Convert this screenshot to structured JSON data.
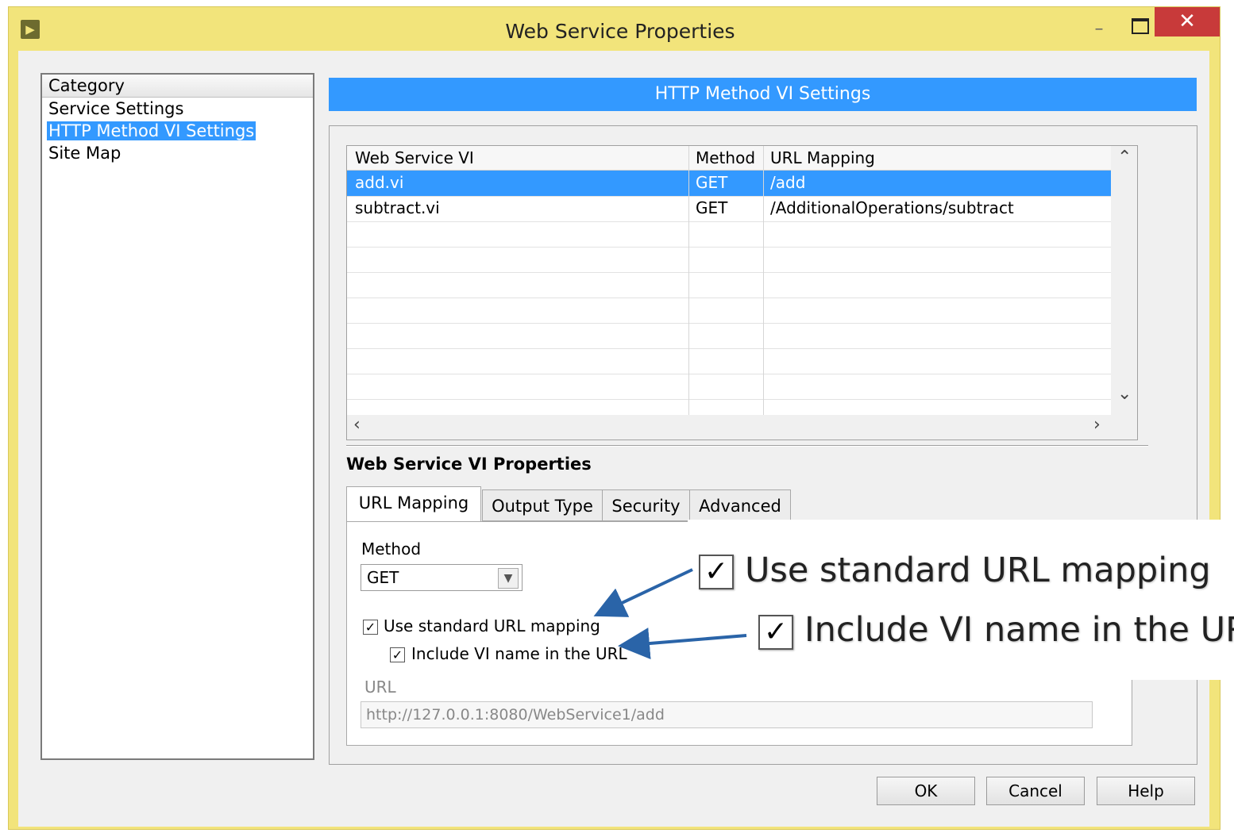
{
  "window": {
    "title": "Web Service Properties"
  },
  "sidebar": {
    "header": "Category",
    "items": [
      {
        "label": "Service Settings",
        "selected": false
      },
      {
        "label": "HTTP Method VI Settings",
        "selected": true
      },
      {
        "label": "Site Map",
        "selected": false
      }
    ]
  },
  "section": {
    "title": "HTTP Method VI Settings"
  },
  "table": {
    "columns": [
      "Web Service VI",
      "Method",
      "URL Mapping"
    ],
    "rows": [
      {
        "vi": "add.vi",
        "method": "GET",
        "url": "/add",
        "selected": true
      },
      {
        "vi": "subtract.vi",
        "method": "GET",
        "url": "/AdditionalOperations/subtract",
        "selected": false
      }
    ]
  },
  "properties": {
    "title": "Web Service VI Properties",
    "tabs": [
      "URL Mapping",
      "Output Type",
      "Security",
      "Advanced"
    ],
    "active_tab": "URL Mapping",
    "method_label": "Method",
    "method_value": "GET",
    "use_standard_label": "Use standard URL mapping",
    "use_standard_checked": true,
    "include_vi_label": "Include VI name in the URL",
    "include_vi_checked": true,
    "url_label": "URL",
    "url_value": "http://127.0.0.1:8080/WebService1/add"
  },
  "callout": {
    "use_standard_label": "Use standard URL mapping",
    "include_vi_label": "Include VI name in the URL"
  },
  "buttons": {
    "ok": "OK",
    "cancel": "Cancel",
    "help": "Help"
  },
  "colors": {
    "titlebar": "#f2e47b",
    "selection": "#3399ff",
    "close": "#c83a3a",
    "arrow": "#2a64a8"
  }
}
